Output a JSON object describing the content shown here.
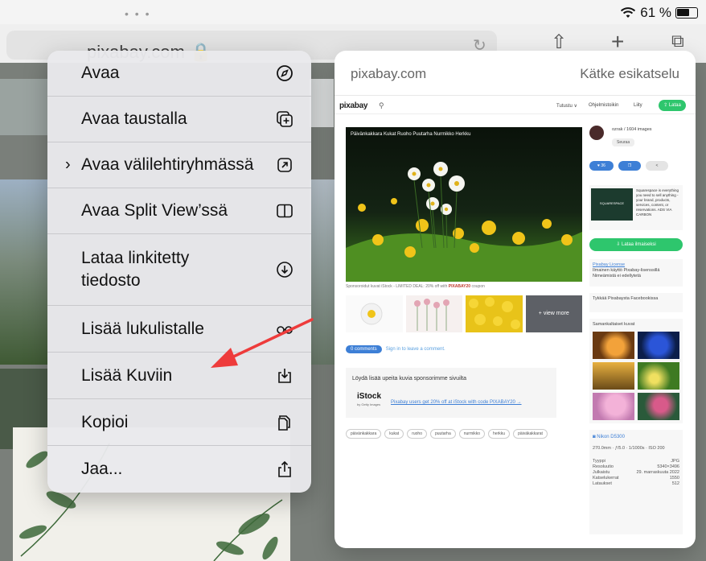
{
  "status": {
    "battery_percent": "61 %"
  },
  "background": {
    "url": "pixabay.com 🔒"
  },
  "menu": {
    "items": [
      {
        "label": "Avaa",
        "icon": "compass-icon"
      },
      {
        "label": "Avaa taustalla",
        "icon": "new-tab-icon"
      },
      {
        "label": "Avaa välilehtiryhmässä",
        "icon": "tab-group-icon",
        "submenu": true
      },
      {
        "label": "Avaa Split View’ssä",
        "icon": "split-view-icon"
      },
      {
        "label": "Lataa linkitetty tiedosto",
        "icon": "download-circle-icon"
      },
      {
        "label": "Lisää lukulistalle",
        "icon": "glasses-icon"
      },
      {
        "label": "Lisää Kuviin",
        "icon": "save-to-photos-icon"
      },
      {
        "label": "Kopioi",
        "icon": "copy-icon"
      },
      {
        "label": "Jaa...",
        "icon": "share-icon"
      }
    ]
  },
  "preview": {
    "url": "pixabay.com",
    "hide_label": "Kätke esikatselu",
    "site": {
      "logo": "pixabay",
      "nav": [
        "Tutustu ∨",
        "Ohjelmistoikin",
        "Liity"
      ],
      "nav_button": "⇪ Lataa",
      "breadcrumbs": "Päivänkakkara  Kukat  Ruoho  Puutarha  Nurmikko  Herkku",
      "sponsor_prefix": "Sponsoroidut kuvat iStock - LIMITED DEAL: 20% off with ",
      "sponsor_code": "PIXABAY20",
      "sponsor_suffix": " coupon",
      "view_more": "+ view more",
      "comments_pill": "0 comments",
      "comments_text": "Sign in to leave a comment.",
      "find_title": "Löydä lisää upeita kuvia sponsorimme sivuilta",
      "istock": "iStock",
      "istock_sub": "by Getty Images",
      "istock_link": "Pixabay users get 20% off at iStock with code PIXABAY20 →",
      "tags": [
        "päivänkakkara",
        "kukat",
        "ruoho",
        "puutarha",
        "nurmikko",
        "herkku",
        "päiväkakkarat"
      ],
      "author": "ozrak / 1604 images",
      "follow": "Seuraa",
      "likes": "♥ 36",
      "ad_brand": "SQUARESPACE",
      "ad_text": "Squarespace is everything you need to sell anything - your brand, products, services, content, or reservations. ADS VIA CARBON",
      "download": "⇩ Lataa ilmaiseksi",
      "license_title": "Pixabay License",
      "license_l1": "Ilmainen käyttö Pixabay-lisenssillä",
      "license_l2": "Nimeämistä ei edellytetä",
      "like_box": "Tykkää Pixabaysta Facebookissa",
      "similar_title": "Samankaltaiset kuvat",
      "camera": "◙ Nikon D5300",
      "camera_specs": "270.0mm · ƒ/5.0 · 1/1000s · ISO 200",
      "info": [
        {
          "k": "Tyyppi",
          "v": "JPG"
        },
        {
          "k": "Resoluutio",
          "v": "5340×3496"
        },
        {
          "k": "Julkaistu",
          "v": "29. marraskuuta 2022"
        },
        {
          "k": "Katselukerrat",
          "v": "1550"
        },
        {
          "k": "Lataukset",
          "v": "512"
        }
      ]
    }
  },
  "colors": {
    "accent_green": "#2ec66d",
    "link_blue": "#3d7fd6",
    "arrow_red": "#ee3b3b"
  }
}
